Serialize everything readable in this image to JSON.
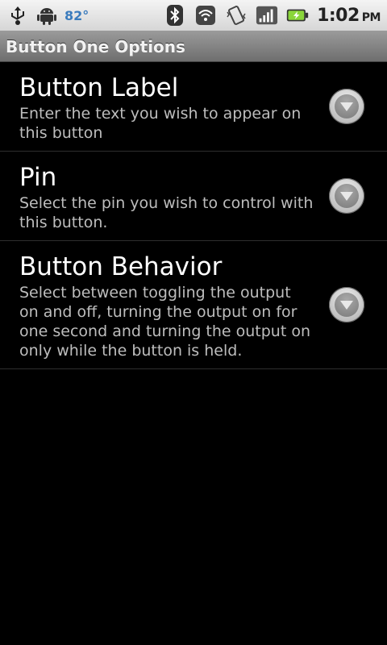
{
  "status_bar": {
    "temperature": "82°",
    "time": "1:02",
    "ampm": "PM",
    "icons": [
      "usb-icon",
      "android-icon",
      "bluetooth-icon",
      "wifi-icon",
      "vibrate-icon",
      "signal-icon",
      "battery-charging-icon"
    ]
  },
  "title_bar": {
    "title": "Button One Options"
  },
  "preferences": [
    {
      "title": "Button Label",
      "summary": "Enter the text you wish to appear on this button"
    },
    {
      "title": "Pin",
      "summary": "Select the pin you wish to control with this button."
    },
    {
      "title": "Button Behavior",
      "summary": "Select between toggling the output on and off, turning the output on for one second and turning the output on only while the button is held."
    }
  ]
}
